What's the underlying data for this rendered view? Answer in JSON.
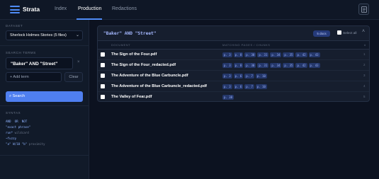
{
  "app": {
    "title": "Strata"
  },
  "nav": {
    "tabs": [
      {
        "label": "Index"
      },
      {
        "label": "Production"
      },
      {
        "label": "Redactions"
      }
    ],
    "active": "Production"
  },
  "sidebar": {
    "dataset_label": "DATASET",
    "dataset_value": "Sherlock Holmes Stories (5 files)",
    "search_terms_label": "SEARCH TERMS",
    "term_value": "\"Baker\" AND \"Street\"",
    "term_remove": "×",
    "add_term_label": "+ Add term",
    "clear_label": "Clear",
    "search_label": "⌕ Search",
    "syntax_label": "SYNTAX",
    "syntax_lines": [
      {
        "code": "AND  OR  NOT",
        "hint": ""
      },
      {
        "code": "\"exact phrase\"",
        "hint": ""
      },
      {
        "code": "run*",
        "hint": " wildcard"
      },
      {
        "code": "~fuzzy",
        "hint": ""
      },
      {
        "code": "\"a\" W/10 \"b\"",
        "hint": " proximity"
      }
    ]
  },
  "results": {
    "query": "\"Baker\" AND \"Street\"",
    "count_label": "5 docs",
    "select_all_label": "Select all",
    "collapse_icon": "chevron-up-icon",
    "columns": {
      "document": "DOCUMENT",
      "pages": "MATCHING PAGES / CHUNKS",
      "order": "#"
    },
    "rows": [
      {
        "name": "The Sign of the Four.pdf",
        "pages": [
          "p. 3",
          "p. 8",
          "p. 30",
          "p. 31",
          "p. 34",
          "p. 35",
          "p. 42",
          "p. 43"
        ],
        "order": "1"
      },
      {
        "name": "The Sign of the Four_redacted.pdf",
        "pages": [
          "p. 3",
          "p. 8",
          "p. 30",
          "p. 31",
          "p. 34",
          "p. 35",
          "p. 42",
          "p. 43"
        ],
        "order": "2"
      },
      {
        "name": "The Adventure of the Blue Carbuncle.pdf",
        "pages": [
          "p. 3",
          "p. 6",
          "p. 7",
          "p. 10"
        ],
        "order": "3"
      },
      {
        "name": "The Adventure of the Blue Carbuncle_redacted.pdf",
        "pages": [
          "p. 3",
          "p. 6",
          "p. 7",
          "p. 10"
        ],
        "order": "4"
      },
      {
        "name": "The Valley of Fear.pdf",
        "pages": [
          "p. 38"
        ],
        "order": "5"
      }
    ]
  },
  "colors": {
    "accent": "#4f7ff0",
    "background": "#0c1220",
    "panel": "#161e2e",
    "chip": "#24376a"
  }
}
